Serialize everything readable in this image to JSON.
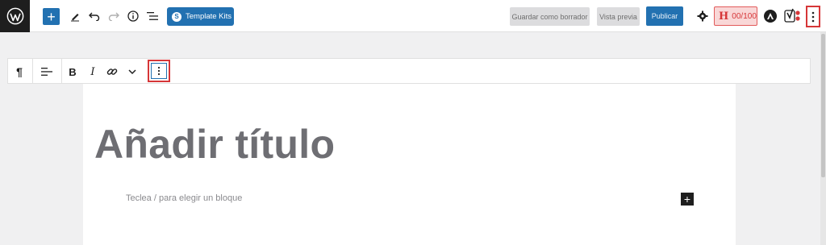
{
  "toolbar": {
    "template_kits_label": "Template Kits",
    "save_draft_label": "Guardar como borrador",
    "preview_label": "Vista previa",
    "publish_label": "Publicar",
    "seo_score": "00/100"
  },
  "editor": {
    "title_placeholder": "Añadir título",
    "block_placeholder": "Teclea / para elegir un bloque"
  },
  "colors": {
    "accent": "#2271b1",
    "highlight": "#d63638",
    "dark": "#1e1e1e"
  }
}
